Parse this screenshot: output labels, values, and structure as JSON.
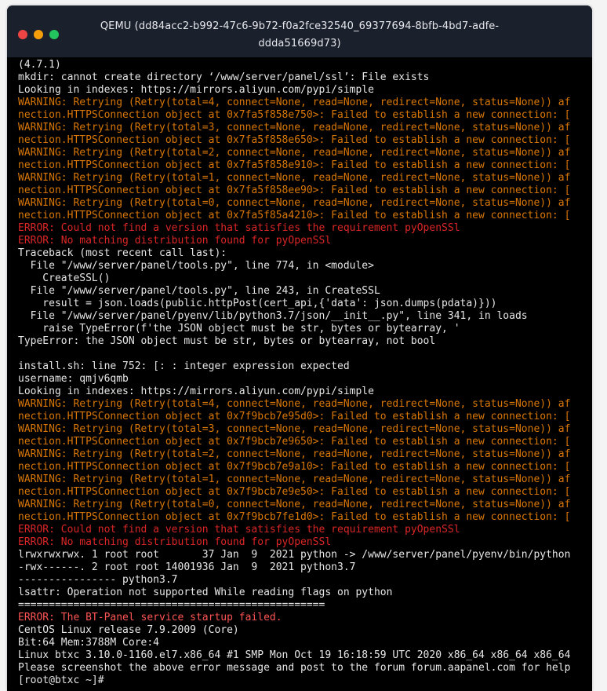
{
  "window": {
    "title": "QEMU (dd84acc2-b992-47c6-9b72-f0a2fce32540_69377694-8bfb-4bd7-adfe-ddda51669d73)"
  },
  "colors": {
    "warning": "#d97706",
    "error": "#dc2626",
    "error_bright": "#ff5555",
    "text": "#e6e6e6"
  },
  "terminal": {
    "lines": [
      {
        "text": "(4.7.1)",
        "style": "normal"
      },
      {
        "text": "mkdir: cannot create directory ‘/www/server/panel/ssl’: File exists",
        "style": "normal"
      },
      {
        "text": "Looking in indexes: https://mirrors.aliyun.com/pypi/simple",
        "style": "normal"
      },
      {
        "text": "WARNING: Retrying (Retry(total=4, connect=None, read=None, redirect=None, status=None)) af",
        "style": "warn"
      },
      {
        "text": "nection.HTTPSConnection object at 0x7fa5f858e750>: Failed to establish a new connection: [",
        "style": "warn"
      },
      {
        "text": "WARNING: Retrying (Retry(total=3, connect=None, read=None, redirect=None, status=None)) af",
        "style": "warn"
      },
      {
        "text": "nection.HTTPSConnection object at 0x7fa5f858e650>: Failed to establish a new connection: [",
        "style": "warn"
      },
      {
        "text": "WARNING: Retrying (Retry(total=2, connect=None, read=None, redirect=None, status=None)) af",
        "style": "warn"
      },
      {
        "text": "nection.HTTPSConnection object at 0x7fa5f858e910>: Failed to establish a new connection: [",
        "style": "warn"
      },
      {
        "text": "WARNING: Retrying (Retry(total=1, connect=None, read=None, redirect=None, status=None)) af",
        "style": "warn"
      },
      {
        "text": "nection.HTTPSConnection object at 0x7fa5f858ee90>: Failed to establish a new connection: [",
        "style": "warn"
      },
      {
        "text": "WARNING: Retrying (Retry(total=0, connect=None, read=None, redirect=None, status=None)) af",
        "style": "warn"
      },
      {
        "text": "nection.HTTPSConnection object at 0x7fa5f85a4210>: Failed to establish a new connection: [",
        "style": "warn"
      },
      {
        "text": "ERROR: Could not find a version that satisfies the requirement pyOpenSSl",
        "style": "err"
      },
      {
        "text": "ERROR: No matching distribution found for pyOpenSSl",
        "style": "err"
      },
      {
        "text": "Traceback (most recent call last):",
        "style": "normal"
      },
      {
        "text": "  File \"/www/server/panel/tools.py\", line 774, in <module>",
        "style": "normal"
      },
      {
        "text": "    CreateSSL()",
        "style": "normal"
      },
      {
        "text": "  File \"/www/server/panel/tools.py\", line 243, in CreateSSL",
        "style": "normal"
      },
      {
        "text": "    result = json.loads(public.httpPost(cert_api,{'data': json.dumps(pdata)}))",
        "style": "normal"
      },
      {
        "text": "  File \"/www/server/panel/pyenv/lib/python3.7/json/__init__.py\", line 341, in loads",
        "style": "normal"
      },
      {
        "text": "    raise TypeError(f'the JSON object must be str, bytes or bytearray, '",
        "style": "normal"
      },
      {
        "text": "TypeError: the JSON object must be str, bytes or bytearray, not bool",
        "style": "normal"
      },
      {
        "text": "",
        "style": "normal"
      },
      {
        "text": "install.sh: line 752: [: : integer expression expected",
        "style": "normal"
      },
      {
        "text": "username: qmjv6qmb",
        "style": "normal"
      },
      {
        "text": "Looking in indexes: https://mirrors.aliyun.com/pypi/simple",
        "style": "normal"
      },
      {
        "text": "WARNING: Retrying (Retry(total=4, connect=None, read=None, redirect=None, status=None)) af",
        "style": "warn"
      },
      {
        "text": "nection.HTTPSConnection object at 0x7f9bcb7e95d0>: Failed to establish a new connection: [",
        "style": "warn"
      },
      {
        "text": "WARNING: Retrying (Retry(total=3, connect=None, read=None, redirect=None, status=None)) af",
        "style": "warn"
      },
      {
        "text": "nection.HTTPSConnection object at 0x7f9bcb7e9650>: Failed to establish a new connection: [",
        "style": "warn"
      },
      {
        "text": "WARNING: Retrying (Retry(total=2, connect=None, read=None, redirect=None, status=None)) af",
        "style": "warn"
      },
      {
        "text": "nection.HTTPSConnection object at 0x7f9bcb7e9a10>: Failed to establish a new connection: [",
        "style": "warn"
      },
      {
        "text": "WARNING: Retrying (Retry(total=1, connect=None, read=None, redirect=None, status=None)) af",
        "style": "warn"
      },
      {
        "text": "nection.HTTPSConnection object at 0x7f9bcb7e9e50>: Failed to establish a new connection: [",
        "style": "warn"
      },
      {
        "text": "WARNING: Retrying (Retry(total=0, connect=None, read=None, redirect=None, status=None)) af",
        "style": "warn"
      },
      {
        "text": "nection.HTTPSConnection object at 0x7f9bcb7fe1d0>: Failed to establish a new connection: [",
        "style": "warn"
      },
      {
        "text": "ERROR: Could not find a version that satisfies the requirement pyOpenSSl",
        "style": "err"
      },
      {
        "text": "ERROR: No matching distribution found for pyOpenSSl",
        "style": "err"
      },
      {
        "text": "lrwxrwxrwx. 1 root root       37 Jan  9  2021 python -> /www/server/panel/pyenv/bin/python",
        "style": "normal"
      },
      {
        "text": "-rwx------. 2 root root 14001936 Jan  9  2021 python3.7",
        "style": "normal"
      },
      {
        "text": "---------------- python3.7",
        "style": "normal"
      },
      {
        "text": "lsattr: Operation not supported While reading flags on python",
        "style": "normal"
      },
      {
        "text": "==================================================",
        "style": "normal"
      },
      {
        "text": "ERROR: The BT-Panel service startup failed.",
        "style": "err-bright"
      },
      {
        "text": "CentOS Linux release 7.9.2009 (Core)",
        "style": "normal"
      },
      {
        "text": "Bit:64 Mem:3788M Core:4",
        "style": "normal"
      },
      {
        "text": "Linux btxc 3.10.0-1160.el7.x86_64 #1 SMP Mon Oct 19 16:18:59 UTC 2020 x86_64 x86_64 x86_64",
        "style": "normal"
      },
      {
        "text": "Please screenshot the above error message and post to the forum forum.aapanel.com for help",
        "style": "normal"
      },
      {
        "text": "[root@btxc ~]#",
        "style": "normal"
      }
    ]
  }
}
